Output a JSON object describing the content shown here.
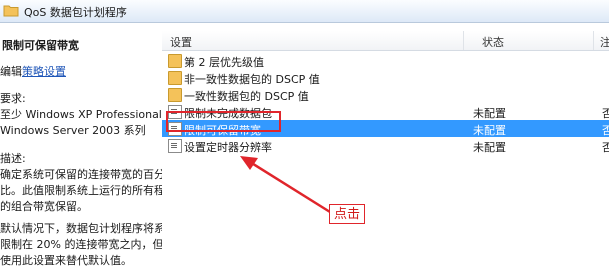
{
  "address_bar": {
    "crumb": "QoS 数据包计划程序"
  },
  "description_pane": {
    "title": "限制可保留带宽",
    "edit_prefix": "编辑",
    "edit_link": "策略设置",
    "requirements_label": "要求:",
    "requirements_line1": "至少 Windows XP Professional 或",
    "requirements_line2": "Windows Server 2003 系列",
    "description_label": "描述:",
    "description_line1": "确定系统可保留的连接带宽的百分",
    "description_line2": "比。此值限制系统上运行的所有程序",
    "description_line3": "的组合带宽保留。",
    "default_line1": "默认情况下，数据包计划程序将系统",
    "default_line2": "限制在 20% 的连接带宽之内，但可以",
    "default_line3": "使用此设置来替代默认值。"
  },
  "list": {
    "col_setting": "设置",
    "col_state": "状态",
    "col_extra": "注",
    "rows": [
      {
        "name": "第 2 层优先级值",
        "type": "folder",
        "state": ""
      },
      {
        "name": "非一致性数据包的 DSCP 值",
        "type": "folder",
        "state": ""
      },
      {
        "name": "一致性数据包的 DSCP 值",
        "type": "folder",
        "state": ""
      },
      {
        "name": "限制未完成数据包",
        "type": "policy",
        "state": "未配置",
        "n": "否"
      },
      {
        "name": "限制可保留带宽",
        "type": "policy",
        "state": "未配置",
        "n": "否",
        "selected": true
      },
      {
        "name": "设置定时器分辨率",
        "type": "policy",
        "state": "未配置",
        "n": "否"
      }
    ]
  },
  "annotation": {
    "label": "点击",
    "color": "#e0252b"
  }
}
